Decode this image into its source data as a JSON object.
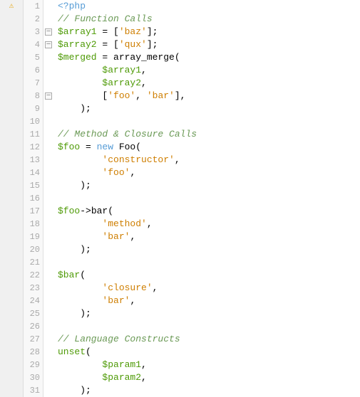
{
  "editor": {
    "lines": [
      {
        "num": 1,
        "fold": "",
        "icon": "warning",
        "tokens": [
          {
            "type": "php-tag",
            "text": "<?php"
          }
        ]
      },
      {
        "num": 2,
        "fold": "",
        "icon": "",
        "tokens": [
          {
            "type": "comment",
            "text": "// Function Calls"
          }
        ]
      },
      {
        "num": 3,
        "fold": "minus",
        "icon": "",
        "tokens": [
          {
            "type": "var",
            "text": "$array1"
          },
          {
            "type": "plain",
            "text": " = ["
          },
          {
            "type": "string",
            "text": "'baz'"
          },
          {
            "type": "plain",
            "text": "];"
          }
        ]
      },
      {
        "num": 4,
        "fold": "minus",
        "icon": "",
        "tokens": [
          {
            "type": "var",
            "text": "$array2"
          },
          {
            "type": "plain",
            "text": " = ["
          },
          {
            "type": "string",
            "text": "'qux'"
          },
          {
            "type": "plain",
            "text": "];"
          }
        ]
      },
      {
        "num": 5,
        "fold": "",
        "icon": "",
        "tokens": [
          {
            "type": "var",
            "text": "$merged"
          },
          {
            "type": "plain",
            "text": " = array_merge("
          }
        ]
      },
      {
        "num": 6,
        "fold": "",
        "icon": "",
        "tokens": [
          {
            "type": "plain",
            "text": "        "
          },
          {
            "type": "var",
            "text": "$array1"
          },
          {
            "type": "plain",
            "text": ","
          }
        ]
      },
      {
        "num": 7,
        "fold": "",
        "icon": "",
        "tokens": [
          {
            "type": "plain",
            "text": "        "
          },
          {
            "type": "var",
            "text": "$array2"
          },
          {
            "type": "plain",
            "text": ","
          }
        ]
      },
      {
        "num": 8,
        "fold": "minus",
        "icon": "",
        "tokens": [
          {
            "type": "plain",
            "text": "        ["
          },
          {
            "type": "string",
            "text": "'foo'"
          },
          {
            "type": "plain",
            "text": ", "
          },
          {
            "type": "string",
            "text": "'bar'"
          },
          {
            "type": "plain",
            "text": "],"
          }
        ]
      },
      {
        "num": 9,
        "fold": "",
        "icon": "",
        "tokens": [
          {
            "type": "plain",
            "text": "    );"
          }
        ]
      },
      {
        "num": 10,
        "fold": "",
        "icon": "",
        "tokens": []
      },
      {
        "num": 11,
        "fold": "",
        "icon": "",
        "tokens": [
          {
            "type": "comment",
            "text": "// Method & Closure Calls"
          }
        ]
      },
      {
        "num": 12,
        "fold": "",
        "icon": "",
        "tokens": [
          {
            "type": "var",
            "text": "$foo"
          },
          {
            "type": "plain",
            "text": " = "
          },
          {
            "type": "kw",
            "text": "new"
          },
          {
            "type": "plain",
            "text": " Foo("
          }
        ]
      },
      {
        "num": 13,
        "fold": "",
        "icon": "",
        "tokens": [
          {
            "type": "plain",
            "text": "        "
          },
          {
            "type": "string",
            "text": "'constructor'"
          },
          {
            "type": "plain",
            "text": ","
          }
        ]
      },
      {
        "num": 14,
        "fold": "",
        "icon": "",
        "tokens": [
          {
            "type": "plain",
            "text": "        "
          },
          {
            "type": "string",
            "text": "'foo'"
          },
          {
            "type": "plain",
            "text": ","
          }
        ]
      },
      {
        "num": 15,
        "fold": "",
        "icon": "",
        "tokens": [
          {
            "type": "plain",
            "text": "    );"
          }
        ]
      },
      {
        "num": 16,
        "fold": "",
        "icon": "",
        "tokens": []
      },
      {
        "num": 17,
        "fold": "",
        "icon": "",
        "tokens": [
          {
            "type": "var",
            "text": "$foo"
          },
          {
            "type": "plain",
            "text": "->bar("
          }
        ]
      },
      {
        "num": 18,
        "fold": "",
        "icon": "",
        "tokens": [
          {
            "type": "plain",
            "text": "        "
          },
          {
            "type": "string",
            "text": "'method'"
          },
          {
            "type": "plain",
            "text": ","
          }
        ]
      },
      {
        "num": 19,
        "fold": "",
        "icon": "",
        "tokens": [
          {
            "type": "plain",
            "text": "        "
          },
          {
            "type": "string",
            "text": "'bar'"
          },
          {
            "type": "plain",
            "text": ","
          }
        ]
      },
      {
        "num": 20,
        "fold": "",
        "icon": "",
        "tokens": [
          {
            "type": "plain",
            "text": "    );"
          }
        ]
      },
      {
        "num": 21,
        "fold": "",
        "icon": "",
        "tokens": []
      },
      {
        "num": 22,
        "fold": "",
        "icon": "",
        "tokens": [
          {
            "type": "var",
            "text": "$bar"
          },
          {
            "type": "plain",
            "text": "("
          }
        ]
      },
      {
        "num": 23,
        "fold": "",
        "icon": "",
        "tokens": [
          {
            "type": "plain",
            "text": "        "
          },
          {
            "type": "string",
            "text": "'closure'"
          },
          {
            "type": "plain",
            "text": ","
          }
        ]
      },
      {
        "num": 24,
        "fold": "",
        "icon": "",
        "tokens": [
          {
            "type": "plain",
            "text": "        "
          },
          {
            "type": "string",
            "text": "'bar'"
          },
          {
            "type": "plain",
            "text": ","
          }
        ]
      },
      {
        "num": 25,
        "fold": "",
        "icon": "",
        "tokens": [
          {
            "type": "plain",
            "text": "    );"
          }
        ]
      },
      {
        "num": 26,
        "fold": "",
        "icon": "",
        "tokens": []
      },
      {
        "num": 27,
        "fold": "",
        "icon": "",
        "tokens": [
          {
            "type": "comment",
            "text": "// Language Constructs"
          }
        ]
      },
      {
        "num": 28,
        "fold": "",
        "icon": "",
        "tokens": [
          {
            "type": "var",
            "text": "unset"
          },
          {
            "type": "plain",
            "text": "("
          }
        ]
      },
      {
        "num": 29,
        "fold": "",
        "icon": "",
        "tokens": [
          {
            "type": "plain",
            "text": "        "
          },
          {
            "type": "var",
            "text": "$param1"
          },
          {
            "type": "plain",
            "text": ","
          }
        ]
      },
      {
        "num": 30,
        "fold": "",
        "icon": "",
        "tokens": [
          {
            "type": "plain",
            "text": "        "
          },
          {
            "type": "var",
            "text": "$param2"
          },
          {
            "type": "plain",
            "text": ","
          }
        ]
      },
      {
        "num": 31,
        "fold": "",
        "icon": "",
        "tokens": [
          {
            "type": "plain",
            "text": "    );"
          }
        ]
      }
    ]
  }
}
